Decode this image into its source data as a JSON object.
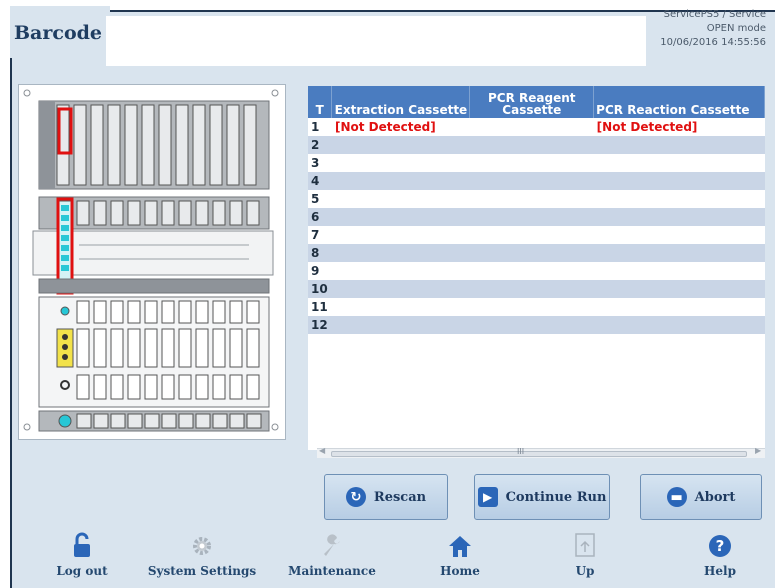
{
  "header": {
    "title": "Barcode",
    "status_line1": "ServicePS5 / Service",
    "status_line2": "OPEN mode",
    "status_line3": "10/06/2016 14:55:56"
  },
  "table": {
    "columns": [
      "T",
      "Extraction Cassette",
      "PCR Reagent Cassette",
      "PCR Reaction Cassette"
    ],
    "rows": [
      {
        "t": "1",
        "extraction": "[Not Detected]",
        "reagent": "",
        "reaction": "[Not Detected]"
      },
      {
        "t": "2",
        "extraction": "",
        "reagent": "",
        "reaction": ""
      },
      {
        "t": "3",
        "extraction": "",
        "reagent": "",
        "reaction": ""
      },
      {
        "t": "4",
        "extraction": "",
        "reagent": "",
        "reaction": ""
      },
      {
        "t": "5",
        "extraction": "",
        "reagent": "",
        "reaction": ""
      },
      {
        "t": "6",
        "extraction": "",
        "reagent": "",
        "reaction": ""
      },
      {
        "t": "7",
        "extraction": "",
        "reagent": "",
        "reaction": ""
      },
      {
        "t": "8",
        "extraction": "",
        "reagent": "",
        "reaction": ""
      },
      {
        "t": "9",
        "extraction": "",
        "reagent": "",
        "reaction": ""
      },
      {
        "t": "10",
        "extraction": "",
        "reagent": "",
        "reaction": ""
      },
      {
        "t": "11",
        "extraction": "",
        "reagent": "",
        "reaction": ""
      },
      {
        "t": "12",
        "extraction": "",
        "reagent": "",
        "reaction": ""
      }
    ],
    "scroll_grip": "III"
  },
  "buttons": {
    "rescan": "Rescan",
    "continue_run": "Continue Run",
    "abort": "Abort"
  },
  "footer": {
    "logout": "Log out",
    "system_settings": "System Settings",
    "maintenance": "Maintenance",
    "home": "Home",
    "up": "Up",
    "help": "Help"
  },
  "colors": {
    "header_blue": "#4a7cc0",
    "row_alt": "#c9d5e6",
    "not_detected": "#e01010",
    "highlight_red": "#e01010",
    "cyan_marker": "#27c7d6",
    "yellow_marker": "#f2e24a"
  },
  "icons": {
    "logout": "open-padlock-icon",
    "system_settings": "gear-icon",
    "maintenance": "wrench-icon",
    "home": "house-icon",
    "up": "up-arrow-document-icon",
    "help": "question-mark-icon",
    "rescan": "refresh-icon",
    "continue_run": "play-icon",
    "abort": "minus-circle-icon"
  }
}
